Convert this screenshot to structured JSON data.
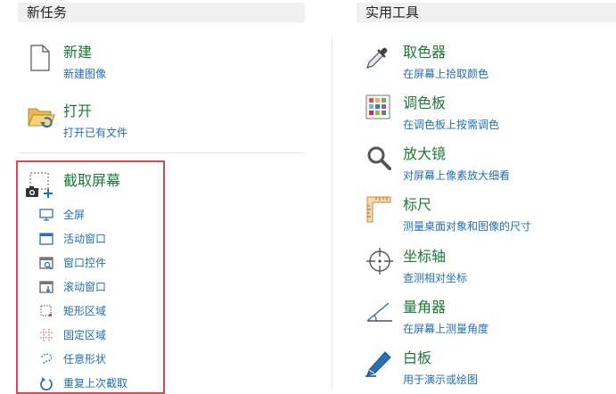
{
  "left_panel": {
    "header": "新任务",
    "new": {
      "title": "新建",
      "desc": "新建图像"
    },
    "open": {
      "title": "打开",
      "desc": "打开已有文件"
    },
    "capture": {
      "title": "截取屏幕",
      "items": [
        {
          "label": "全屏",
          "icon": "monitor-icon"
        },
        {
          "label": "活动窗口",
          "icon": "window-icon"
        },
        {
          "label": "窗口控件",
          "icon": "window-control-icon"
        },
        {
          "label": "滚动窗口",
          "icon": "scroll-window-icon"
        },
        {
          "label": "矩形区域",
          "icon": "rectangle-region-icon"
        },
        {
          "label": "固定区域",
          "icon": "fixed-region-icon"
        },
        {
          "label": "任意形状",
          "icon": "freeform-icon"
        },
        {
          "label": "重复上次截取",
          "icon": "repeat-icon"
        }
      ]
    }
  },
  "right_panel": {
    "header": "实用工具",
    "tools": [
      {
        "title": "取色器",
        "desc": "在屏幕上拾取颜色",
        "icon": "eyedropper-icon"
      },
      {
        "title": "调色板",
        "desc": "在调色板上按需调色",
        "icon": "palette-icon"
      },
      {
        "title": "放大镜",
        "desc": "对屏幕上像素放大细看",
        "icon": "magnifier-icon"
      },
      {
        "title": "标尺",
        "desc": "测量桌面对象和图像的尺寸",
        "icon": "ruler-icon"
      },
      {
        "title": "坐标轴",
        "desc": "查测相对坐标",
        "icon": "crosshair-icon"
      },
      {
        "title": "量角器",
        "desc": "在屏幕上测量角度",
        "icon": "protractor-icon"
      },
      {
        "title": "白板",
        "desc": "用于演示或绘图",
        "icon": "whiteboard-pen-icon"
      }
    ]
  },
  "colors": {
    "title_green": "#1b7a35",
    "link_blue": "#1f6fb8",
    "highlight_red": "#e0474c"
  }
}
